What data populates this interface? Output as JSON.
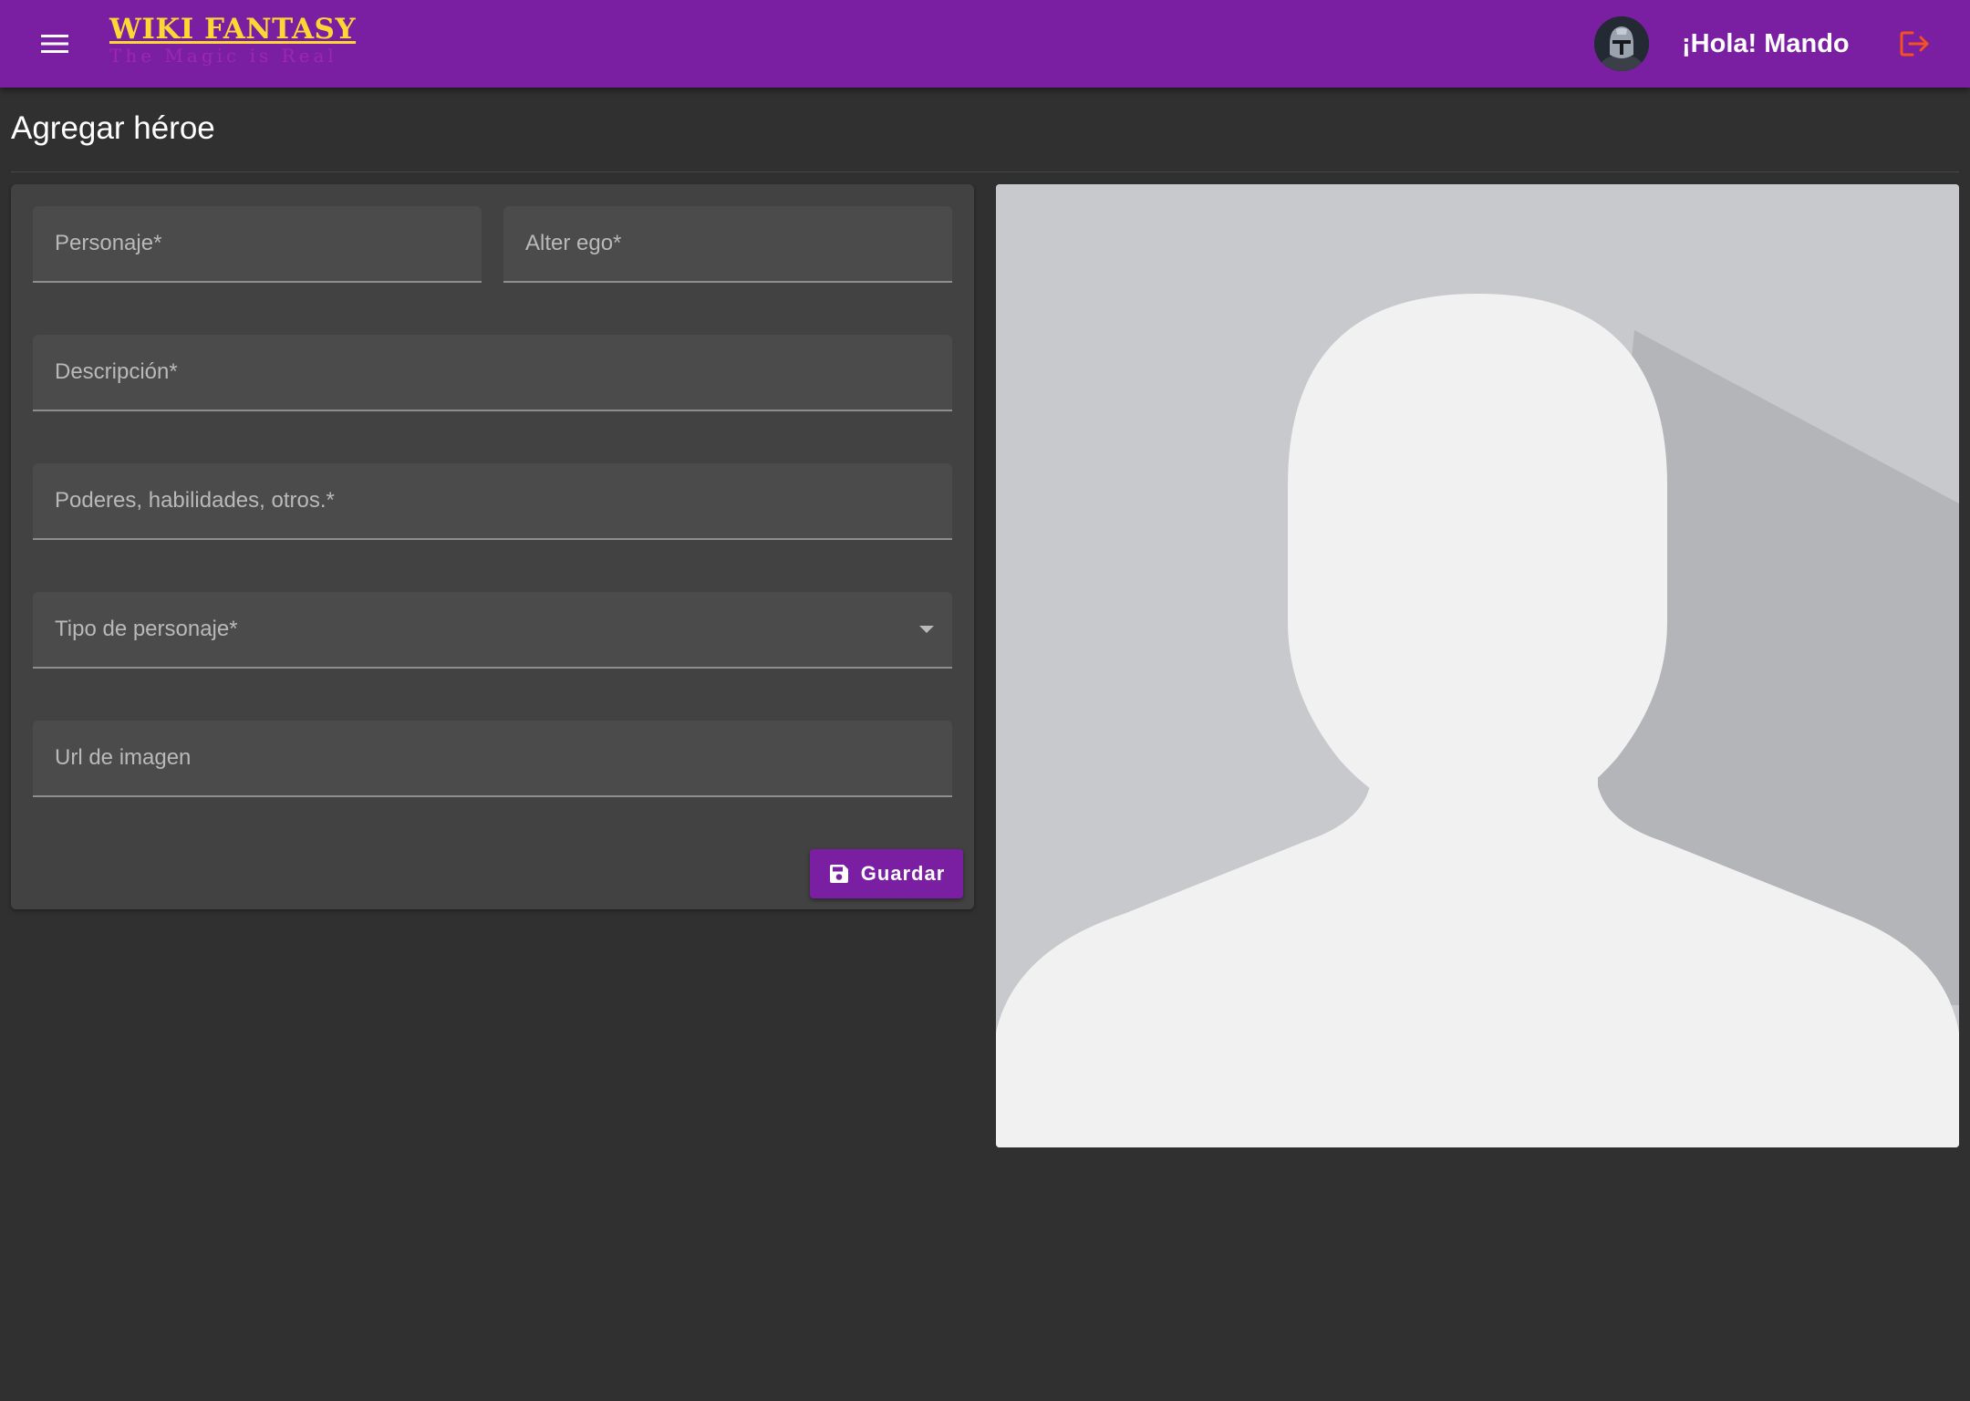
{
  "app": {
    "logo_title": "WIKI FANTASY",
    "logo_subtitle": "The Magic is Real",
    "greeting": "¡Hola! Mando"
  },
  "icons": {
    "menu": "hamburger-menu-icon",
    "logout": "logout-icon",
    "save": "floppy-disk-icon",
    "dropdown": "arrow-drop-down-icon"
  },
  "colors": {
    "toolbar": "#7b1fa2",
    "logo_title": "#fdd835",
    "logo_subtitle": "#9c27b0",
    "logout_icon": "#f4511e",
    "background": "#303030",
    "card": "#424242"
  },
  "page": {
    "title": "Agregar héroe"
  },
  "form": {
    "personaje": {
      "placeholder": "Personaje*",
      "value": ""
    },
    "alter_ego": {
      "placeholder": "Alter ego*",
      "value": ""
    },
    "descripcion": {
      "placeholder": "Descripción*",
      "value": ""
    },
    "poderes": {
      "placeholder": "Poderes, habilidades, otros.*",
      "value": ""
    },
    "tipo": {
      "placeholder": "Tipo de personaje*",
      "value": ""
    },
    "url_imagen": {
      "placeholder": "Url de imagen",
      "value": ""
    },
    "save_label": "Guardar"
  }
}
